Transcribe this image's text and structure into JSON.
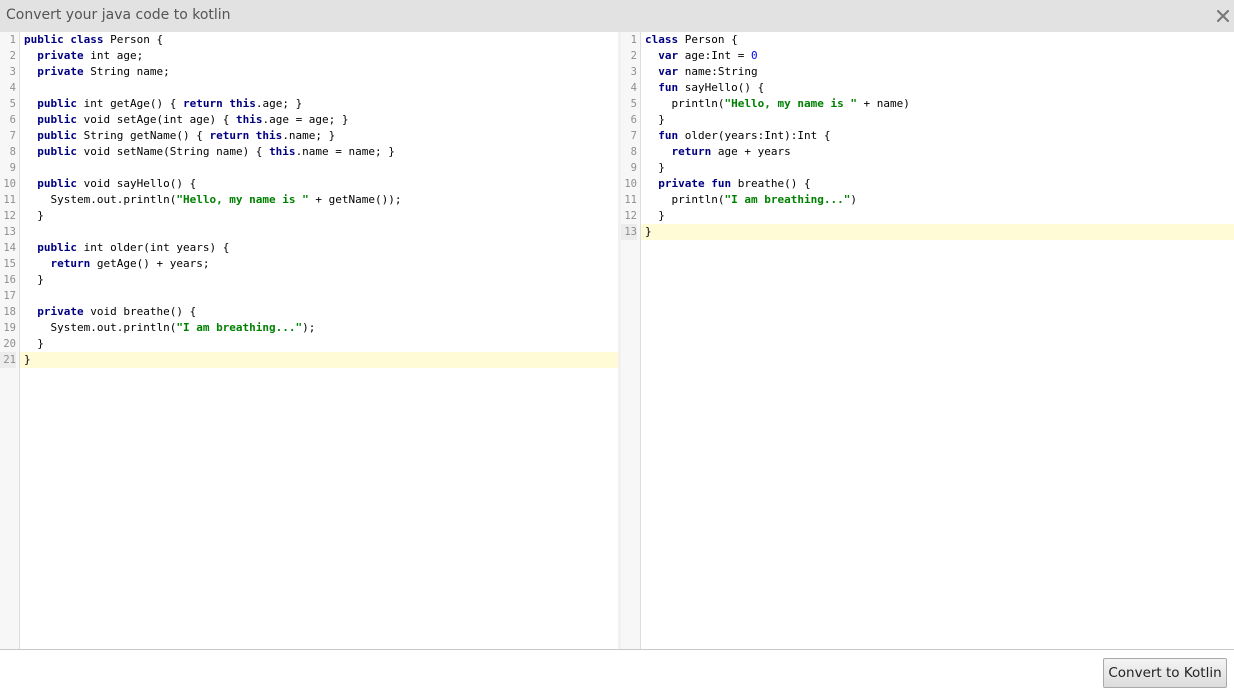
{
  "dialog": {
    "title": "Convert your java code to kotlin",
    "close_icon": "close-icon"
  },
  "java_editor": {
    "language": "Java",
    "lines": [
      [
        {
          "t": "public class",
          "k": "kw"
        },
        {
          "t": " Person {"
        }
      ],
      [
        {
          "t": "  "
        },
        {
          "t": "private",
          "k": "kw"
        },
        {
          "t": " int age;"
        }
      ],
      [
        {
          "t": "  "
        },
        {
          "t": "private",
          "k": "kw"
        },
        {
          "t": " String name;"
        }
      ],
      [],
      [
        {
          "t": "  "
        },
        {
          "t": "public",
          "k": "kw"
        },
        {
          "t": " int getAge() { "
        },
        {
          "t": "return this",
          "k": "kw"
        },
        {
          "t": ".age; }"
        }
      ],
      [
        {
          "t": "  "
        },
        {
          "t": "public",
          "k": "kw"
        },
        {
          "t": " void setAge(int age) { "
        },
        {
          "t": "this",
          "k": "kw"
        },
        {
          "t": ".age = age; }"
        }
      ],
      [
        {
          "t": "  "
        },
        {
          "t": "public",
          "k": "kw"
        },
        {
          "t": " String getName() { "
        },
        {
          "t": "return this",
          "k": "kw"
        },
        {
          "t": ".name; }"
        }
      ],
      [
        {
          "t": "  "
        },
        {
          "t": "public",
          "k": "kw"
        },
        {
          "t": " void setName(String name) { "
        },
        {
          "t": "this",
          "k": "kw"
        },
        {
          "t": ".name = name; }"
        }
      ],
      [],
      [
        {
          "t": "  "
        },
        {
          "t": "public",
          "k": "kw"
        },
        {
          "t": " void sayHello() {"
        }
      ],
      [
        {
          "t": "    System.out.println("
        },
        {
          "t": "\"Hello, my name is \"",
          "k": "str"
        },
        {
          "t": " + getName());"
        }
      ],
      [
        {
          "t": "  }"
        }
      ],
      [],
      [
        {
          "t": "  "
        },
        {
          "t": "public",
          "k": "kw"
        },
        {
          "t": " int older(int years) {"
        }
      ],
      [
        {
          "t": "    "
        },
        {
          "t": "return",
          "k": "kw"
        },
        {
          "t": " getAge() + years;"
        }
      ],
      [
        {
          "t": "  }"
        }
      ],
      [],
      [
        {
          "t": "  "
        },
        {
          "t": "private",
          "k": "kw"
        },
        {
          "t": " void breathe() {"
        }
      ],
      [
        {
          "t": "    System.out.println("
        },
        {
          "t": "\"I am breathing...\"",
          "k": "str"
        },
        {
          "t": ");"
        }
      ],
      [
        {
          "t": "  }"
        }
      ],
      [
        {
          "t": "}"
        }
      ]
    ],
    "active_line": 21
  },
  "kotlin_editor": {
    "language": "Kotlin",
    "lines": [
      [
        {
          "t": "class",
          "k": "kw"
        },
        {
          "t": " Person {"
        }
      ],
      [
        {
          "t": "  "
        },
        {
          "t": "var",
          "k": "kw"
        },
        {
          "t": " age:Int = "
        },
        {
          "t": "0",
          "k": "num"
        }
      ],
      [
        {
          "t": "  "
        },
        {
          "t": "var",
          "k": "kw"
        },
        {
          "t": " name:String"
        }
      ],
      [
        {
          "t": "  "
        },
        {
          "t": "fun",
          "k": "kw"
        },
        {
          "t": " sayHello() {"
        }
      ],
      [
        {
          "t": "    println("
        },
        {
          "t": "\"Hello, my name is \"",
          "k": "str"
        },
        {
          "t": " + name)"
        }
      ],
      [
        {
          "t": "  }"
        }
      ],
      [
        {
          "t": "  "
        },
        {
          "t": "fun",
          "k": "kw"
        },
        {
          "t": " older(years:Int):Int {"
        }
      ],
      [
        {
          "t": "    "
        },
        {
          "t": "return",
          "k": "kw"
        },
        {
          "t": " age + years"
        }
      ],
      [
        {
          "t": "  }"
        }
      ],
      [
        {
          "t": "  "
        },
        {
          "t": "private fun",
          "k": "kw"
        },
        {
          "t": " breathe() {"
        }
      ],
      [
        {
          "t": "    println("
        },
        {
          "t": "\"I am breathing...\"",
          "k": "str"
        },
        {
          "t": ")"
        }
      ],
      [
        {
          "t": "  }"
        }
      ],
      [
        {
          "t": "}"
        }
      ]
    ],
    "active_line": 13
  },
  "footer": {
    "convert_label": "Convert to Kotlin"
  },
  "colors": {
    "keyword": "#000080",
    "string": "#008000",
    "number": "#0000ff",
    "active_line": "#fffbd6",
    "titlebar": "#e2e2e2"
  }
}
